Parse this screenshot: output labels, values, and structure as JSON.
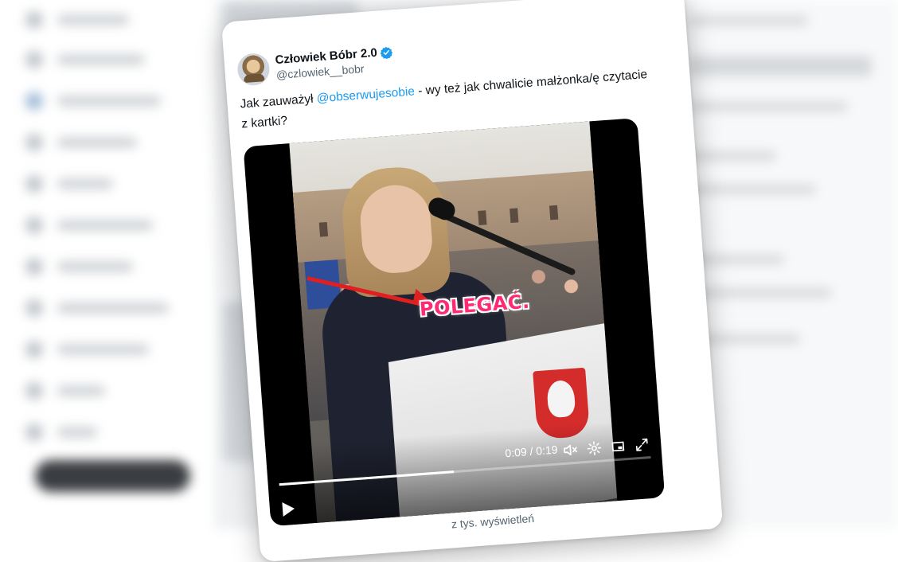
{
  "card": {
    "display_name": "Człowiek Bóbr 2.0",
    "handle": "@czlowiek__bobr",
    "text_before": "Jak zauważył ",
    "mention": "@obserwujesobie",
    "text_after": " - wy też jak chwalicie małżonka/ę czytacie z kartki?",
    "more_label": "···",
    "footer_partial": "z tys. wyświetleń"
  },
  "video": {
    "caption": "POLEGAĆ.",
    "current_time": "0:09",
    "duration": "0:19",
    "time_text": "0:09 / 0:19",
    "progress_fraction": 0.47
  },
  "icons": {
    "verified": "verified-badge-icon",
    "volume": "volume-muted-icon",
    "settings": "gear-icon",
    "pip": "picture-in-picture-icon",
    "fullscreen": "fullscreen-icon",
    "play": "play-icon"
  },
  "colors": {
    "link": "#1d9bf0",
    "verified": "#1d9bf0",
    "caption": "#ff2a74",
    "arrow": "#e02020"
  }
}
